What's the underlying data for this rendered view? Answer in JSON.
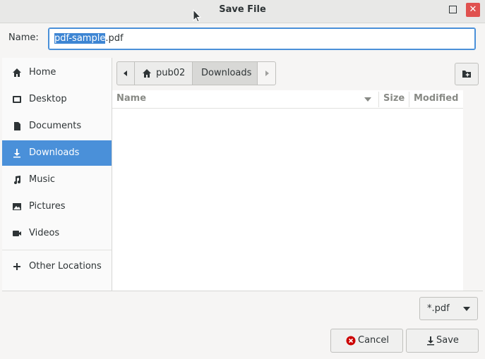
{
  "window": {
    "title": "Save File"
  },
  "name_row": {
    "label": "Name:",
    "value_selected": "pdf-sample",
    "value_rest": ".pdf"
  },
  "sidebar": {
    "items": [
      {
        "label": "Home",
        "icon": "home-icon"
      },
      {
        "label": "Desktop",
        "icon": "desktop-icon"
      },
      {
        "label": "Documents",
        "icon": "document-icon"
      },
      {
        "label": "Downloads",
        "icon": "download-icon",
        "active": true
      },
      {
        "label": "Music",
        "icon": "music-icon"
      },
      {
        "label": "Pictures",
        "icon": "picture-icon"
      },
      {
        "label": "Videos",
        "icon": "video-icon"
      },
      {
        "label": "Other Locations",
        "icon": "plus-icon"
      }
    ]
  },
  "pathbar": {
    "home_label": "pub02",
    "current_label": "Downloads"
  },
  "filelist": {
    "columns": [
      "Name",
      "Size",
      "Modified"
    ]
  },
  "filter": {
    "value": "*.pdf"
  },
  "buttons": {
    "cancel": "Cancel",
    "save": "Save"
  },
  "colors": {
    "accent": "#4a90d9",
    "close": "#e0514f",
    "selection": "#3d85d3"
  }
}
